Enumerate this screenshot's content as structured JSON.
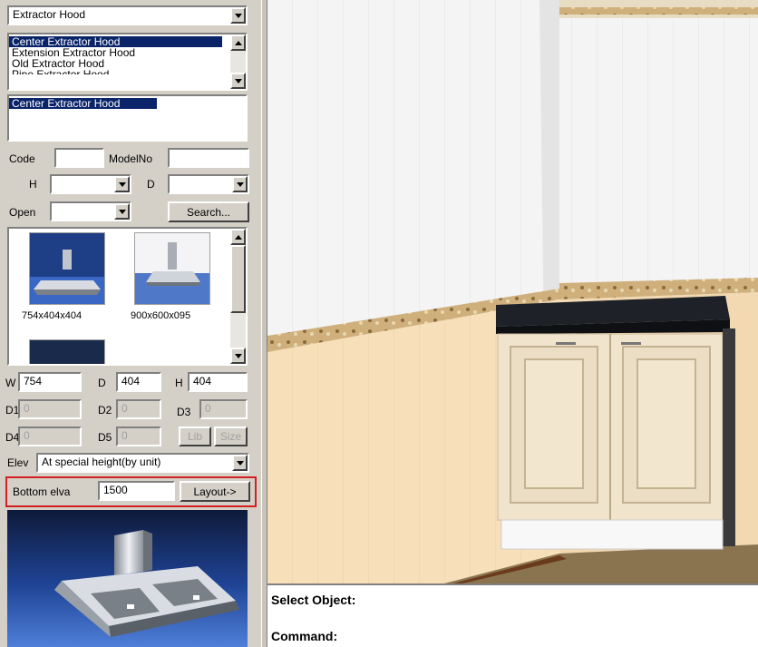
{
  "category_select": {
    "value": "Extractor Hood"
  },
  "model_list": {
    "items": [
      "Center Extractor Hood",
      "Extension Extractor Hood",
      "Old Extractor Hood",
      "Pipe Extractor Hood"
    ],
    "selected_index": 0
  },
  "selected_model": {
    "value": "Center Extractor Hood"
  },
  "filters": {
    "code_label": "Code",
    "code_value": "",
    "modelno_label": "ModelNo",
    "modelno_value": "",
    "h_label": "H",
    "h_value": "",
    "d_label": "D",
    "d_value": "",
    "open_label": "Open",
    "open_value": "",
    "search_label": "Search..."
  },
  "thumbnails": [
    {
      "label": "754x404x404"
    },
    {
      "label": "900x600x095"
    }
  ],
  "dims": {
    "w_label": "W",
    "w_value": "754",
    "d_label": "D",
    "d_value": "404",
    "h_label": "H",
    "h_value": "404",
    "d1_label": "D1",
    "d1_value": "0",
    "d2_label": "D2",
    "d2_value": "0",
    "d3_label": "D3",
    "d3_value": "0",
    "d4_label": "D4",
    "d4_value": "0",
    "d5_label": "D5",
    "d5_value": "0",
    "lib_label": "Lib",
    "size_label": "Size"
  },
  "elev": {
    "label": "Elev",
    "value": "At special height(by unit)"
  },
  "bottom_elva": {
    "label": "Bottom elva",
    "value": "1500",
    "layout_label": "Layout->"
  },
  "command": {
    "line1": "Select Object:",
    "line2": "Command:"
  },
  "colors": {
    "highlight": "#d42020",
    "selection": "#0a246a",
    "panel": "#d4d0c8"
  }
}
